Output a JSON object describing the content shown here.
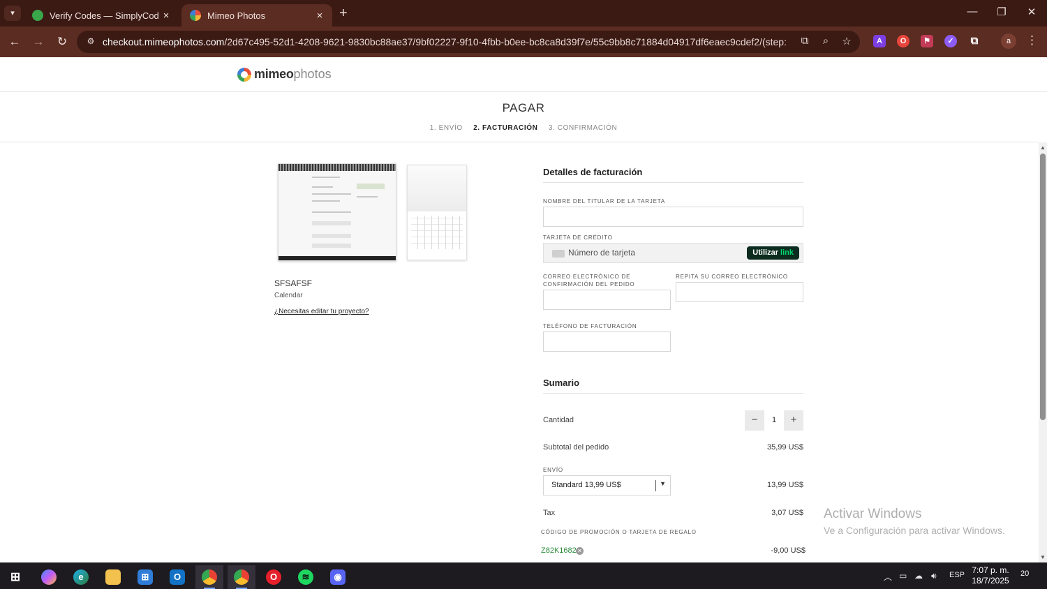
{
  "browser": {
    "tabs": [
      {
        "title": "Verify Codes — SimplyCodes",
        "favicon": "simplycodes-icon",
        "active": false
      },
      {
        "title": "Mimeo Photos",
        "favicon": "mimeo-icon",
        "active": true
      }
    ],
    "url_host": "checkout.mimeophotos.com",
    "url_path": "/2d67c495-52d1-4208-9621-9830bc88ae37/9bf02227-9f10-4fbb-b0ee-bc8ca8d39f7e/55c9bb8c71884d04917df6eaec9cdef2/(step:payment)",
    "profile_initial": "a",
    "extensions": [
      "A",
      "O"
    ]
  },
  "header": {
    "logo_bold": "mimeo",
    "logo_light": "photos",
    "title": "PAGAR",
    "steps": [
      "1. ENVÍO",
      "2. FACTURACIÓN",
      "3. CONFIRMACIÓN"
    ],
    "active_step": 1
  },
  "project": {
    "name": "SFSAFSF",
    "type": "Calendar",
    "edit_link": "¿Necesitas editar tu proyecto?"
  },
  "billing": {
    "title": "Detalles de facturación",
    "cardholder_label": "NOMBRE DEL TITULAR DE LA TARJETA",
    "cardholder_value": "",
    "card_label": "TARJETA DE CRÉDITO",
    "card_placeholder": "Número de tarjeta",
    "link_button_prefix": "Utilizar",
    "link_button_brand": "link",
    "email_label": "CORREO ELECTRÓNICO DE CONFIRMACIÓN DEL PEDIDO",
    "email_value": "",
    "email_repeat_label": "REPITA SU CORREO ELECTRÓNICO",
    "email_repeat_value": "",
    "phone_label": "TELÉFONO DE FACTURACIÓN",
    "phone_value": ""
  },
  "summary": {
    "title": "Sumario",
    "quantity_label": "Cantidad",
    "quantity": "1",
    "minus": "−",
    "plus": "+",
    "subtotal_label": "Subtotal del pedido",
    "subtotal_value": "35,99 US$",
    "shipping_label": "ENVÍO",
    "shipping_selected": "Standard 13,99 US$",
    "shipping_value": "13,99 US$",
    "tax_label": "Tax",
    "tax_value": "3,07 US$",
    "promo_label": "CÓDIGO DE PROMOCIÓN O TARJETA DE REGALO",
    "promo_code": "Z82K1682",
    "promo_value": "-9,00 US$"
  },
  "watermark": {
    "line1": "Activar Windows",
    "line2": "Ve a Configuración para activar Windows."
  },
  "taskbar": {
    "language": "ESP",
    "time": "7:07 p. m.",
    "date": "18/7/2025",
    "notifications": "20",
    "apps": [
      "start-icon",
      "copilot-icon",
      "edge-icon",
      "file-explorer-icon",
      "store-icon",
      "outlook-icon",
      "chrome-icon",
      "chrome-icon",
      "opera-icon",
      "spotify-icon",
      "discord-icon"
    ]
  },
  "colors": {
    "chrome_dark": "#3b1a14",
    "chrome_toolbar": "#5b2c22",
    "link_button": "#0b2c1e",
    "link_green": "#00d66f",
    "promo_green": "#2c8a3c"
  }
}
